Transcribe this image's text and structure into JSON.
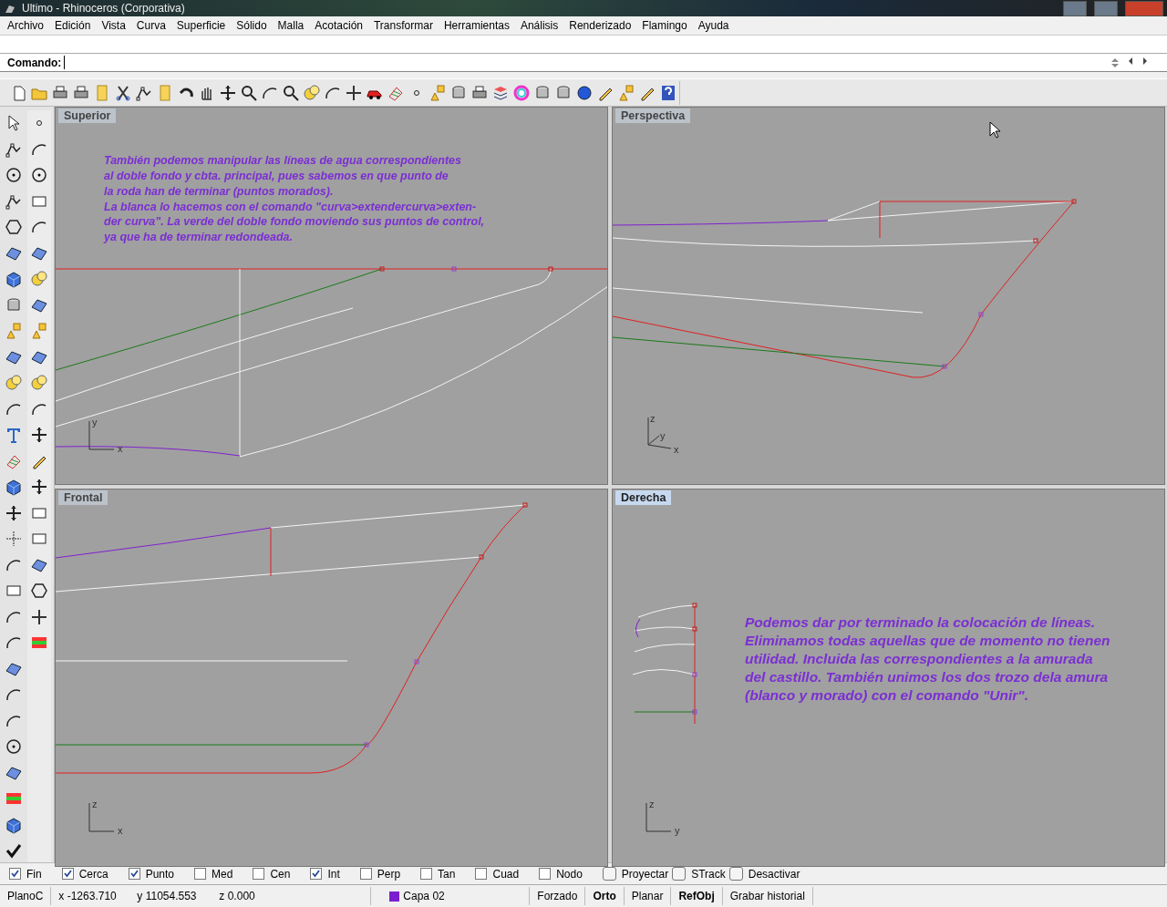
{
  "window": {
    "title": "Ultimo - Rhinoceros (Corporativa)"
  },
  "menu": [
    "Archivo",
    "Edición",
    "Vista",
    "Curva",
    "Superficie",
    "Sólido",
    "Malla",
    "Acotación",
    "Transformar",
    "Herramientas",
    "Análisis",
    "Renderizado",
    "Flamingo",
    "Ayuda"
  ],
  "command": {
    "label": "Comando:"
  },
  "viewports": [
    {
      "kind": "top",
      "title": "Superior",
      "selected": false,
      "axes": [
        "y",
        "x"
      ],
      "note_lines": [
        "También podemos manipular las líneas de agua correspondientes",
        "al doble fondo y cbta. principal, pues sabemos en que punto de",
        "la roda han de terminar (puntos morados).",
        "La blanca lo hacemos con el comando \"curva>extendercurva>exten-",
        "der curva\". La verde del doble fondo moviendo sus puntos de control,",
        "ya que ha de terminar redondeada."
      ]
    },
    {
      "kind": "perspective",
      "title": "Perspectiva",
      "selected": false,
      "axes": [
        "z",
        "y",
        "x"
      ]
    },
    {
      "kind": "front",
      "title": "Frontal",
      "selected": false,
      "axes": [
        "z",
        "x"
      ]
    },
    {
      "kind": "right",
      "title": "Derecha",
      "selected": true,
      "axes": [
        "z",
        "y"
      ],
      "note_lines": [
        "Podemos dar por terminado la colocación de líneas.",
        "Eliminamos todas aquellas que de momento no tienen",
        "utilidad. Incluida las correspondientes a la amurada",
        "del castillo. También unimos los dos trozo dela amura",
        "(blanco y morado) con el comando \"Unir\"."
      ]
    }
  ],
  "osnaps": [
    {
      "kind": "check",
      "label": "Fin",
      "checked": true
    },
    {
      "kind": "check",
      "label": "Cerca",
      "checked": true
    },
    {
      "kind": "check",
      "label": "Punto",
      "checked": true
    },
    {
      "kind": "check",
      "label": "Med",
      "checked": false
    },
    {
      "kind": "check",
      "label": "Cen",
      "checked": false
    },
    {
      "kind": "check",
      "label": "Int",
      "checked": true
    },
    {
      "kind": "check",
      "label": "Perp",
      "checked": false
    },
    {
      "kind": "check",
      "label": "Tan",
      "checked": false
    },
    {
      "kind": "check",
      "label": "Cuad",
      "checked": false
    },
    {
      "kind": "check",
      "label": "Nodo",
      "checked": false
    },
    {
      "kind": "toggle",
      "label": "Proyectar",
      "checked": false
    },
    {
      "kind": "toggle",
      "label": "STrack",
      "checked": false
    },
    {
      "kind": "toggle",
      "label": "Desactivar",
      "checked": false
    }
  ],
  "status_bar": {
    "cplane": "PlanoC",
    "x": "x -1263.710",
    "y": "y 11054.553",
    "z": "z 0.000",
    "layer": {
      "name": "Capa 02",
      "color": "#7a1fd0"
    },
    "toggles": [
      {
        "label": "Forzado",
        "on": false
      },
      {
        "label": "Orto",
        "on": true
      },
      {
        "label": "Planar",
        "on": false
      },
      {
        "label": "RefObj",
        "on": true
      },
      {
        "label": "Grabar historial",
        "on": false
      }
    ]
  }
}
